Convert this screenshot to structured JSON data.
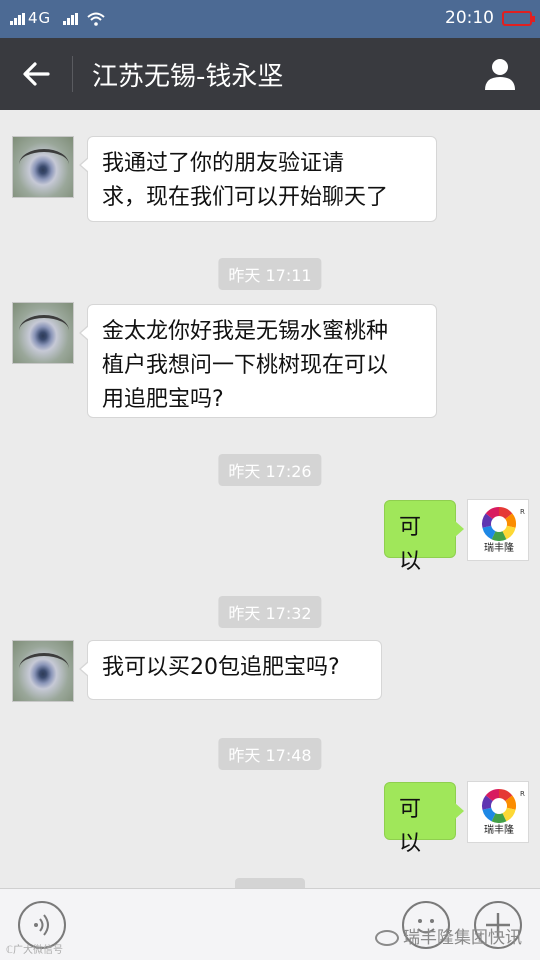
{
  "status_bar": {
    "left": "4G",
    "time": "20:10"
  },
  "header": {
    "title": "江苏无锡-钱永坚"
  },
  "messages": [
    {
      "side": "left",
      "text_lines": [
        "我通过了你的朋友验证请",
        "求，现在我们可以开始聊天了"
      ]
    },
    {
      "timestamp": "昨天 17:11"
    },
    {
      "side": "left",
      "text_lines": [
        "金太龙你好我是无锡水蜜桃种",
        "植户我想问一下桃树现在可以",
        "用追肥宝吗?"
      ]
    },
    {
      "timestamp": "昨天 17:26"
    },
    {
      "side": "right",
      "text": "可以"
    },
    {
      "timestamp": "昨天 17:32"
    },
    {
      "side": "left",
      "text": "我可以买20包追肥宝吗?"
    },
    {
      "timestamp": "昨天 17:48"
    },
    {
      "side": "right",
      "text": "可以"
    }
  ],
  "brand_avatar": {
    "label": "瑞丰隆",
    "mark": "R",
    "wheel_colors": [
      "#e53935",
      "#fb8c00",
      "#fdd835",
      "#43a047",
      "#1e88e5",
      "#5e35b1",
      "#d81b60"
    ]
  },
  "footer": {
    "watermark": "瑞丰隆集团快讯",
    "watermark_left": "ℂ广大微信号"
  },
  "icons": {
    "back": "back-arrow-icon",
    "profile": "person-icon",
    "voice": "voice-icon",
    "emoji": "emoji-icon",
    "add": "plus-icon"
  }
}
